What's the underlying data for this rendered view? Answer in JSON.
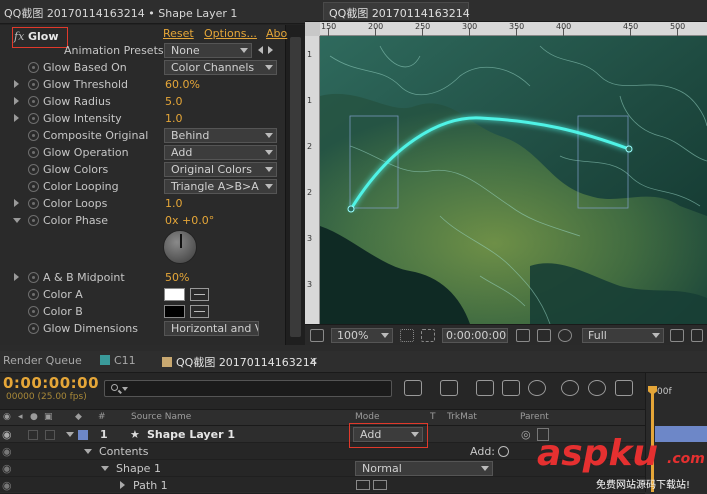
{
  "effect_controls": {
    "header_title": "QQ截图 20170114163214 • Shape Layer 1",
    "effect_name": "Glow",
    "fx_label": "fx",
    "reset_label": "Reset",
    "options_label": "Options...",
    "about_label": "Abo",
    "animation_presets_label": "Animation Presets:",
    "animation_presets_value": "None",
    "properties": [
      {
        "label": "Glow Based On",
        "type": "dropdown",
        "value": "Color Channels"
      },
      {
        "label": "Glow Threshold",
        "type": "value",
        "value": "60.0%"
      },
      {
        "label": "Glow Radius",
        "type": "value",
        "value": "5.0"
      },
      {
        "label": "Glow Intensity",
        "type": "value",
        "value": "1.0"
      },
      {
        "label": "Composite Original",
        "type": "dropdown",
        "value": "Behind"
      },
      {
        "label": "Glow Operation",
        "type": "dropdown",
        "value": "Add"
      },
      {
        "label": "Glow Colors",
        "type": "dropdown",
        "value": "Original Colors"
      },
      {
        "label": "Color Looping",
        "type": "dropdown",
        "value": "Triangle A>B>A"
      },
      {
        "label": "Color Loops",
        "type": "value",
        "value": "1.0"
      },
      {
        "label": "Color Phase",
        "type": "value",
        "value": "0x +0.0°"
      },
      {
        "label": "A & B Midpoint",
        "type": "value",
        "value": "50%"
      },
      {
        "label": "Color A",
        "type": "color",
        "value": "#ffffff"
      },
      {
        "label": "Color B",
        "type": "color",
        "value": "#000000"
      },
      {
        "label": "Glow Dimensions",
        "type": "dropdown",
        "value": "Horizontal and Vertical"
      }
    ]
  },
  "composition": {
    "tab_label": "QQ截图 20170114163214",
    "ruler_labels": [
      "150",
      "200",
      "250",
      "300",
      "350",
      "400",
      "450",
      "500"
    ],
    "ruler_left_labels": [
      "1",
      "1",
      "2",
      "2",
      "3",
      "3"
    ],
    "toolbar": {
      "zoom": "100%",
      "timecode": "0:00:00:00",
      "resolution": "Full"
    }
  },
  "timeline": {
    "tabs": [
      {
        "label": "Render Queue",
        "active": false
      },
      {
        "label": "C11",
        "active": false,
        "color": "#3a9a9a"
      },
      {
        "label": "QQ截图 20170114163214",
        "active": true,
        "color": "#c8a870"
      }
    ],
    "close_label": "×",
    "timecode": "0:00:00:00",
    "fps": "00000 (25.00 fps)",
    "search_placeholder": "",
    "columns": {
      "hash": "#",
      "source_name": "Source Name",
      "mode": "Mode",
      "t": "T",
      "trkmat": "TrkMat",
      "parent": "Parent"
    },
    "ruler_label": "00f",
    "layers": [
      {
        "number": "1",
        "name": "Shape Layer 1",
        "mode": "Add"
      }
    ],
    "contents_label": "Contents",
    "add_label": "Add:",
    "shape_label": "Shape 1",
    "shape_mode": "Normal",
    "path_label": "Path 1"
  },
  "watermark": {
    "brand": "aspku",
    "suffix": ".com",
    "tagline": "免费网站源码下载站!"
  },
  "colors": {
    "accent_orange": "#e5a638",
    "highlight_red": "#e0392b",
    "glow_cyan": "#4ff3e6",
    "layer_blue": "#6d87c8"
  }
}
